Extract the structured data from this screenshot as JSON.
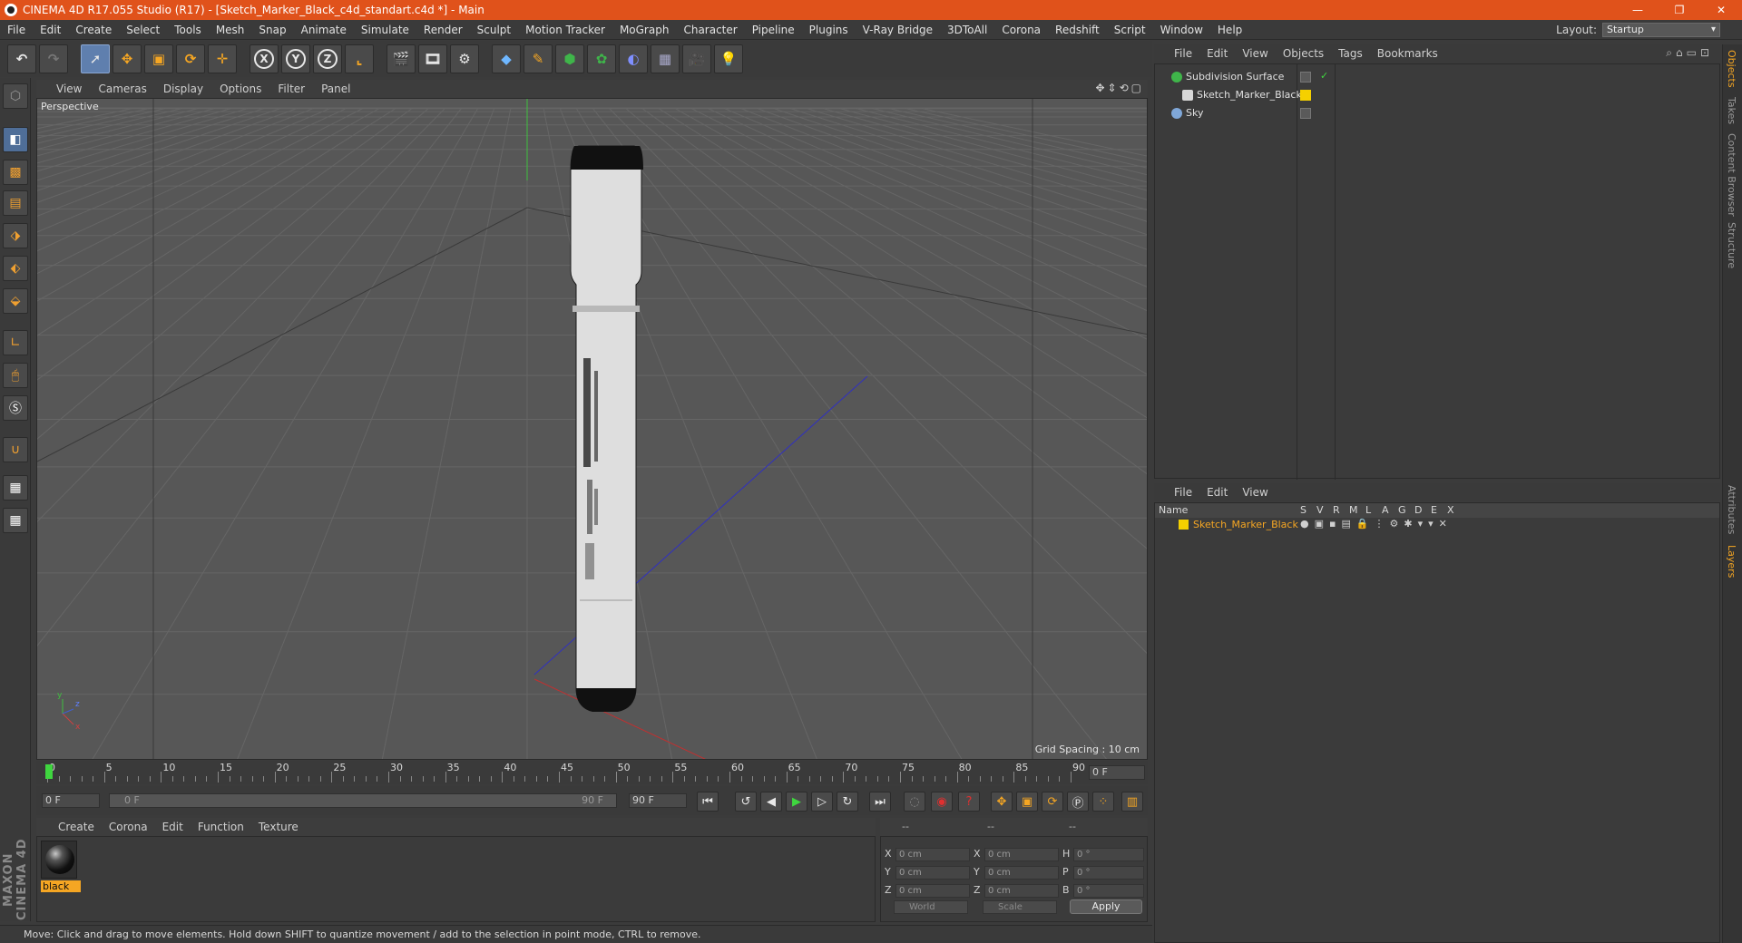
{
  "window": {
    "title": "CINEMA 4D R17.055 Studio (R17) - [Sketch_Marker_Black_c4d_standart.c4d *] - Main",
    "controls": [
      "—",
      "❐",
      "✕"
    ]
  },
  "menubar": {
    "items": [
      "File",
      "Edit",
      "Create",
      "Select",
      "Tools",
      "Mesh",
      "Snap",
      "Animate",
      "Simulate",
      "Render",
      "Sculpt",
      "Motion Tracker",
      "MoGraph",
      "Character",
      "Pipeline",
      "Plugins",
      "V-Ray Bridge",
      "3DToAll",
      "Corona",
      "Redshift",
      "Script",
      "Window",
      "Help"
    ],
    "layout_label": "Layout:",
    "layout_value": "Startup"
  },
  "toolbar": {
    "axis_x": "X",
    "axis_y": "Y",
    "axis_z": "Z"
  },
  "viewport": {
    "menu": [
      "View",
      "Cameras",
      "Display",
      "Options",
      "Filter",
      "Panel"
    ],
    "nav_icons": "✥⇕⟲▢",
    "label": "Perspective",
    "grid_spacing": "Grid Spacing : 10 cm",
    "axis_y": "y",
    "axis_z": "z",
    "axis_x": "x"
  },
  "timeline": {
    "ticks": [
      "0",
      "5",
      "10",
      "15",
      "20",
      "25",
      "30",
      "35",
      "40",
      "45",
      "50",
      "55",
      "60",
      "65",
      "70",
      "75",
      "80",
      "85",
      "90"
    ],
    "current_frame": "0 F",
    "start_field": "0 F",
    "range_start": "0 F",
    "range_end": "90 F",
    "end_field": "90 F"
  },
  "material_manager": {
    "menu": [
      "Create",
      "Corona",
      "Edit",
      "Function",
      "Texture"
    ],
    "materials": [
      {
        "name": "black"
      }
    ]
  },
  "coordinates": {
    "header": [
      "--",
      "--",
      "--"
    ],
    "rows": [
      {
        "l1": "X",
        "v1": "0 cm",
        "l2": "X",
        "v2": "0 cm",
        "l3": "H",
        "v3": "0 °"
      },
      {
        "l1": "Y",
        "v1": "0 cm",
        "l2": "Y",
        "v2": "0 cm",
        "l3": "P",
        "v3": "0 °"
      },
      {
        "l1": "Z",
        "v1": "0 cm",
        "l2": "Z",
        "v2": "0 cm",
        "l3": "B",
        "v3": "0 °"
      }
    ],
    "mode_world": "World",
    "mode_scale": "Scale",
    "apply": "Apply"
  },
  "status": {
    "text": "Move: Click and drag to move elements. Hold down SHIFT to quantize movement / add to the selection in point mode, CTRL to remove."
  },
  "object_manager": {
    "menu": [
      "File",
      "Edit",
      "View",
      "Objects",
      "Tags",
      "Bookmarks"
    ],
    "objects": [
      {
        "name": "Subdivision Surface",
        "icon_color": "#3fb54a"
      },
      {
        "name": "Sketch_Marker_Black",
        "icon_color": "#d8d8d8"
      },
      {
        "name": "Sky",
        "icon_color": "#7fa7d8"
      }
    ]
  },
  "layer_manager": {
    "menu": [
      "File",
      "Edit",
      "View"
    ],
    "columns": [
      "Name",
      "S",
      "V",
      "R",
      "M",
      "L",
      "A",
      "G",
      "D",
      "E",
      "X"
    ],
    "layers": [
      {
        "name": "Sketch_Marker_Black",
        "color": "#f5d000"
      }
    ]
  },
  "side_tabs": [
    "Objects",
    "Takes",
    "Content Browser",
    "Structure",
    "Attributes",
    "Layers"
  ],
  "maxon_logo": "MAXON CINEMA 4D"
}
